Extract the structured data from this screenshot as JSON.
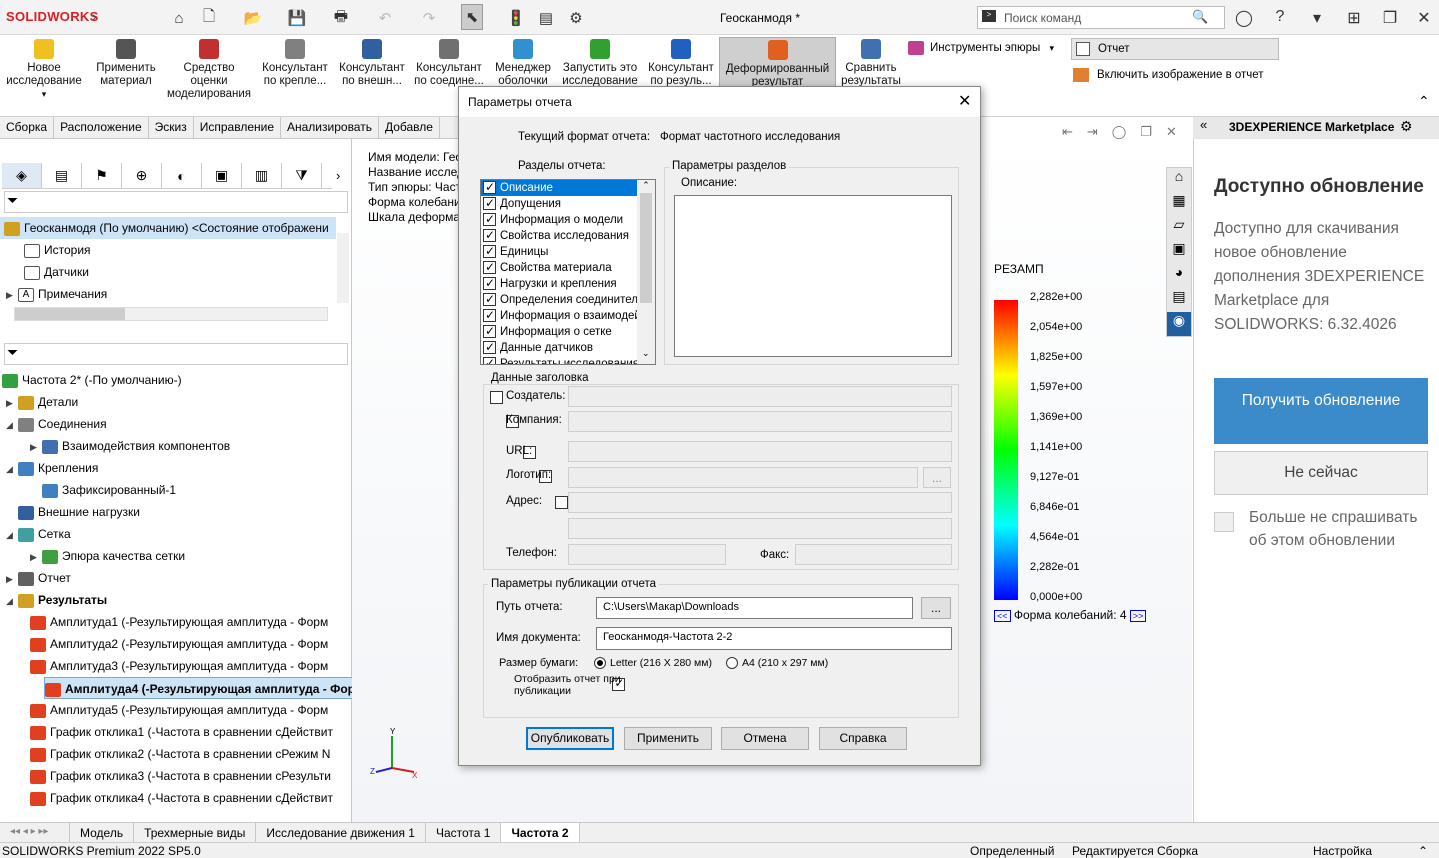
{
  "app": {
    "logo": "SOLIDWORKS",
    "doc_title": "Геосканмодя *",
    "search_placeholder": "Поиск команд"
  },
  "ribbon": {
    "items": [
      {
        "label": "Новое исследование",
        "color": "#f0c020"
      },
      {
        "label": "Применить материал",
        "color": "#555555"
      },
      {
        "label": "Средство оценки моделирования",
        "color": "#c03030"
      },
      {
        "label": "Консультант по крепле...",
        "color": "#808080"
      },
      {
        "label": "Консультант по внешн...",
        "color": "#3060a0"
      },
      {
        "label": "Консультант по соедине...",
        "color": "#707070"
      },
      {
        "label": "Менеджер оболочки",
        "color": "#3090d0"
      },
      {
        "label": "Запустить это исследование",
        "color": "#30a030"
      },
      {
        "label": "Консультант по резуль...",
        "color": "#2060c0"
      },
      {
        "label": "Деформированный результат",
        "color": "#e06020"
      },
      {
        "label": "Сравнить результаты",
        "color": "#4070b0"
      }
    ],
    "epure_tools": "Инструменты эпюры",
    "report": "Отчет",
    "include_image": "Включить изображение в отчет"
  },
  "cmdtabs": [
    "Сборка",
    "Расположение",
    "Эскиз",
    "Исправление",
    "Анализировать",
    "Добавле"
  ],
  "tree_top": {
    "root": "Геосканмодя (По умолчанию) <Состояние отображени",
    "items": [
      "История",
      "Датчики",
      "Примечания"
    ]
  },
  "study_tree": [
    {
      "label": "Частота 2* (-По умолчанию-)",
      "level": 0,
      "bold": false,
      "color": "#30a040"
    },
    {
      "label": "Детали",
      "level": 1,
      "bold": false,
      "color": "#d0a020"
    },
    {
      "label": "Соединения",
      "level": 1,
      "bold": false,
      "color": "#808080"
    },
    {
      "label": "Взаимодействия компонентов",
      "level": 2,
      "bold": false,
      "color": "#4070b0"
    },
    {
      "label": "Крепления",
      "level": 1,
      "bold": false,
      "color": "#4080c0"
    },
    {
      "label": "Зафиксированный-1",
      "level": 2,
      "bold": false,
      "color": "#4080c0"
    },
    {
      "label": "Внешние нагрузки",
      "level": 1,
      "bold": false,
      "color": "#3060a0"
    },
    {
      "label": "Сетка",
      "level": 1,
      "bold": false,
      "color": "#40a0a0"
    },
    {
      "label": "Эпюра качества сетки",
      "level": 2,
      "bold": false,
      "color": "#40a040"
    },
    {
      "label": "Отчет",
      "level": 1,
      "bold": false,
      "color": "#606060"
    },
    {
      "label": "Результаты",
      "level": 1,
      "bold": true,
      "color": "#d0a020"
    },
    {
      "label": "Амплитуда1 (-Результирующая амплитуда - Форм",
      "level": 2,
      "bold": false,
      "color": "#e04020"
    },
    {
      "label": "Амплитуда2 (-Результирующая амплитуда - Форм",
      "level": 2,
      "bold": false,
      "color": "#e04020"
    },
    {
      "label": "Амплитуда3 (-Результирующая амплитуда - Форм",
      "level": 2,
      "bold": false,
      "color": "#e04020"
    },
    {
      "label": "Амплитуда4 (-Результирующая амплитуда - Фор",
      "level": 2,
      "bold": true,
      "color": "#e04020"
    },
    {
      "label": "Амплитуда5 (-Результирующая амплитуда - Форм",
      "level": 2,
      "bold": false,
      "color": "#e04020"
    },
    {
      "label": "График отклика1 (-Частота в сравнении сДействит",
      "level": 2,
      "bold": false,
      "color": "#e04020"
    },
    {
      "label": "График отклика2 (-Частота в сравнении сРежим N",
      "level": 2,
      "bold": false,
      "color": "#e04020"
    },
    {
      "label": "График отклика3 (-Частота в сравнении сРезульти",
      "level": 2,
      "bold": false,
      "color": "#e04020"
    },
    {
      "label": "График отклика4 (-Частота в сравнении сДействит",
      "level": 2,
      "bold": false,
      "color": "#e04020"
    }
  ],
  "graphics_info": [
    "Имя модели: Гео",
    "Название исслед",
    "Тип эпюры: Част",
    "Форма колебани",
    "Шкала деформац"
  ],
  "legend": {
    "title": "РЕЗАМП",
    "values": [
      "2,282e+00",
      "2,054e+00",
      "1,825e+00",
      "1,597e+00",
      "1,369e+00",
      "1,141e+00",
      "9,127e-01",
      "6,846e-01",
      "4,564e-01",
      "2,282e-01",
      "0,000e+00"
    ],
    "mode_label": "Форма колебаний: 4"
  },
  "marketplace": {
    "title": "3DEXPERIENCE Marketplace",
    "heading": "Доступно обновление",
    "body": "Доступно для скачивания новое обновление дополнения 3DEXPERIENCE Marketplace для SOLIDWORKS: 6.32.4026",
    "get_update": "Получить обновление",
    "not_now": "Не сейчас",
    "dont_ask": "Больше не спрашивать об этом обновлении"
  },
  "bottom_tabs": [
    "Модель",
    "Трехмерные виды",
    "Исследование движения 1",
    "Частота 1",
    "Частота 2"
  ],
  "status": {
    "left": "SOLIDWORKS Premium 2022 SP5.0",
    "mid1": "Определенный",
    "mid2": "Редактируется Сборка",
    "right": "Настройка"
  },
  "dialog": {
    "title": "Параметры отчета",
    "format_label": "Текущий формат отчета:",
    "format_value": "Формат частотного исследования",
    "sections_label": "Разделы отчета:",
    "sections": [
      "Описание",
      "Допущения",
      "Информация о модели",
      "Свойства исследования",
      "Единицы",
      "Свойства материала",
      "Нагрузки и крепления",
      "Определения соединителей",
      "Информация о взаимодействии",
      "Информация о сетке",
      "Данные датчиков",
      "Результаты исследования"
    ],
    "section_params_label": "Параметры разделов",
    "description_label": "Описание:",
    "header_group": "Данные заголовка",
    "creator": "Создатель:",
    "company": "Компания:",
    "url": "URL:",
    "logo": "Логотип:",
    "address": "Адрес:",
    "phone": "Телефон:",
    "fax": "Факс:",
    "browse": "...",
    "publish_group": "Параметры публикации отчета",
    "path_label": "Путь отчета:",
    "path_value": "C:\\Users\\Макар\\Downloads",
    "docname_label": "Имя документа:",
    "docname_value": "Геосканмодя-Частота 2-2",
    "paper_label": "Размер бумаги:",
    "paper_letter": "Letter (216 X 280 мм)",
    "paper_a4": "A4 (210 x 297 мм)",
    "show_report": "Отобразить отчет при публикации",
    "btn_publish": "Опубликовать",
    "btn_apply": "Применить",
    "btn_cancel": "Отмена",
    "btn_help": "Справка"
  }
}
